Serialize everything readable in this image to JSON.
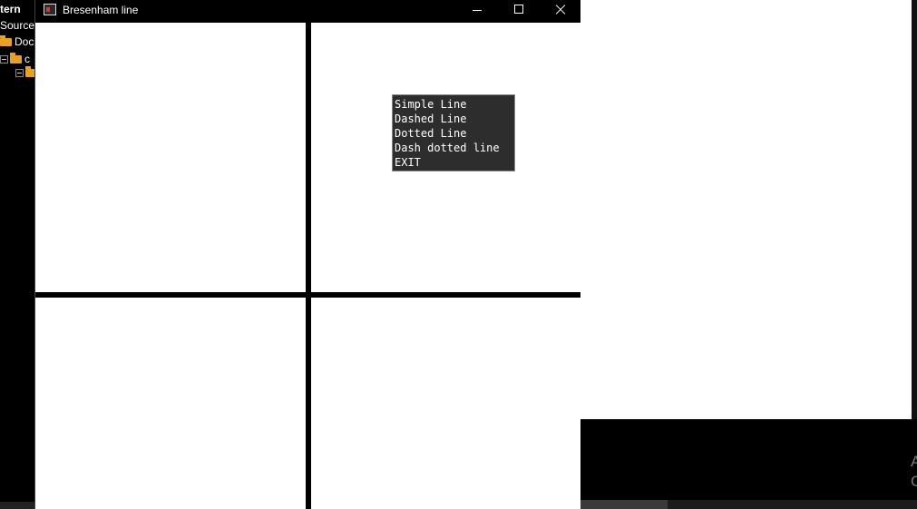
{
  "ide": {
    "title": "tern",
    "sources_label": "Sources",
    "tree_item_label": "Doc",
    "tree_item_2": "c"
  },
  "window": {
    "title": "Bresenham line"
  },
  "menu": {
    "items": [
      "Simple Line",
      "Dashed Line",
      "Dotted Line",
      "Dash dotted line",
      "EXIT"
    ]
  },
  "watermark": {
    "line1": "A",
    "line2": "G"
  }
}
